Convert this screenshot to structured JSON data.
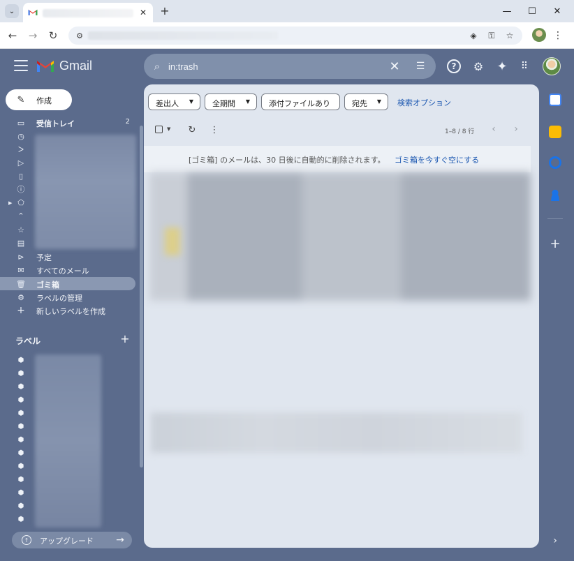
{
  "browser": {
    "tab_close": "✕",
    "new_tab": "+",
    "window_controls": {
      "minimize": "—",
      "maximize": "☐",
      "close": "✕"
    },
    "nav": {
      "back": "←",
      "forward": "→",
      "reload": "↻"
    },
    "menu": "⋮"
  },
  "header": {
    "app_name": "Gmail",
    "search": {
      "value": "in:trash",
      "placeholder": ""
    }
  },
  "compose": {
    "label": "作成"
  },
  "sidebar": {
    "items": [
      {
        "label": "受信トレイ",
        "count": "2"
      },
      {
        "label": "予定"
      },
      {
        "label": "すべてのメール"
      },
      {
        "label": "ゴミ箱"
      },
      {
        "label": "ラベルの管理"
      },
      {
        "label": "新しいラベルを作成"
      }
    ],
    "labels_title": "ラベル",
    "labels_add": "+"
  },
  "upgrade": {
    "label": "アップグレード"
  },
  "filters": {
    "chips": [
      {
        "label": "差出人"
      },
      {
        "label": "全期間"
      },
      {
        "label": "添付ファイルあり"
      },
      {
        "label": "宛先"
      }
    ],
    "search_options": "検索オプション"
  },
  "list_toolbar": {
    "pager": "1–8 / 8 行"
  },
  "trash_banner": {
    "message": "[ゴミ箱] のメールは、30 日後に自動的に削除されます。",
    "empty_action": "ゴミ箱を今すぐ空にする"
  },
  "colors": {
    "app_bg": "#5b6b8c",
    "main_bg": "#e0e6ef",
    "link": "#1a56b0",
    "active_nav": "#8a98b2"
  },
  "icons": {
    "search": "search-icon",
    "clear": "close-icon",
    "tune": "tune-icon",
    "help": "help-icon",
    "settings": "gear-icon",
    "gemini": "sparkle-icon",
    "apps": "apps-grid-icon"
  }
}
